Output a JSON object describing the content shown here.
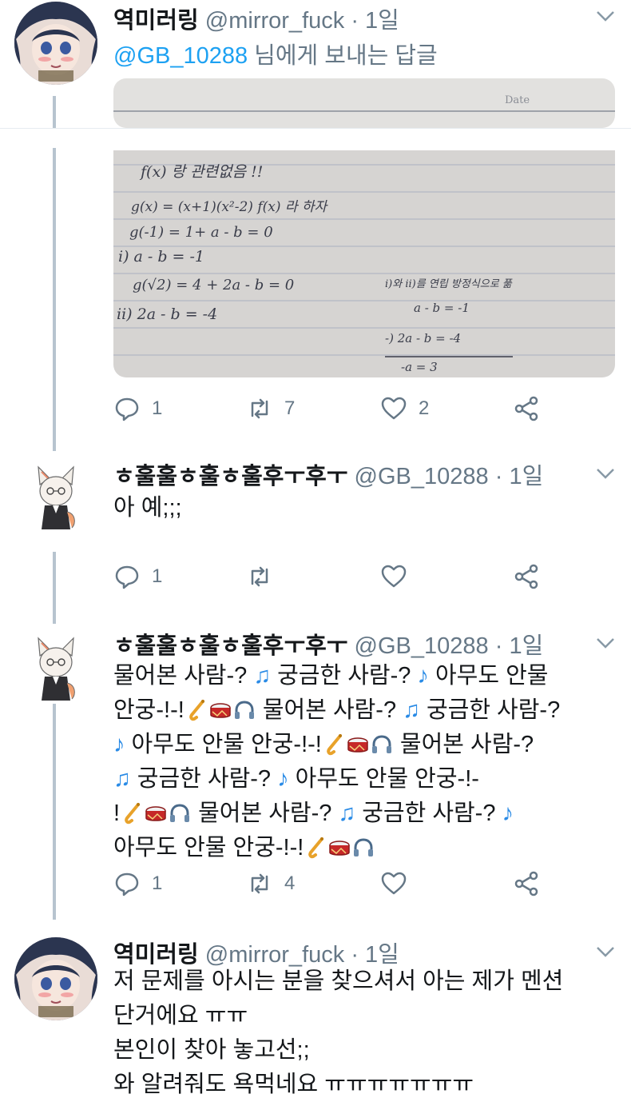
{
  "tweets": [
    {
      "name": "역미러링",
      "handle": "@mirror_fuck",
      "dot": "·",
      "time": "1일",
      "reply_mention": "@GB_10288",
      "reply_rest": " 님에게 보내는 답글",
      "image_top_label": "Date",
      "math_lines": [
        "f(x) 랑 관련없음 !!",
        "g(x) = (x+1)(x²-2) f(x) 라 하자",
        "g(-1) = 1+ a - b = 0",
        "i) a - b = -1",
        "g(√2) = 4 + 2a - b = 0",
        "ii) 2a - b = -4",
        "i)와 ii)를 연립 방정식으로 풂",
        "a - b = -1",
        "-) 2a - b = -4",
        "-a = 3"
      ],
      "replies": "1",
      "retweets": "7",
      "likes": "2"
    },
    {
      "name": "ㅎ훌훌ㅎ훌ㅎ훌후ㅜ후ㅜ",
      "handle": "@GB_10288",
      "dot": "·",
      "time": "1일",
      "text": "아 예;;;",
      "replies": "1",
      "retweets": "",
      "likes": ""
    },
    {
      "name": "ㅎ훌훌ㅎ훌ㅎ훌후ㅜ후ㅜ",
      "handle": "@GB_10288",
      "dot": "·",
      "time": "1일",
      "lines": [
        [
          "물어본 사람-? ",
          "♫",
          " 궁금한 사람-? ",
          "♪",
          " 아무도 안물"
        ],
        [
          "안궁-!-!",
          "",
          " 물어본 사람-? ",
          "♫",
          " 궁금한 사람-?"
        ],
        [
          "♪",
          " 아무도 안물 안궁-!-!",
          "",
          " 물어본 사람-?"
        ],
        [
          "♫",
          " 궁금한 사람-? ",
          "♪",
          " 아무도 안물 안궁-!-"
        ],
        [
          "!",
          "",
          " 물어본 사람-? ",
          "♫",
          " 궁금한 사람-? ",
          "♪"
        ],
        [
          "아무도 안물 안궁-!-!",
          ""
        ]
      ],
      "replies": "1",
      "retweets": "4",
      "likes": ""
    },
    {
      "name": "역미러링",
      "handle": "@mirror_fuck",
      "dot": "·",
      "time": "1일",
      "text_lines": [
        "저 문제를 아시는 분을 찾으셔서 아는 제가 멘션",
        "단거에요 ㅠㅠ",
        "본인이 찾아 놓고선;;",
        "와 알려줘도 욕먹네요 ㅠㅠㅠㅠㅠㅠㅠ"
      ]
    }
  ],
  "colors": {
    "accent": "#1da1f2",
    "muted": "#657786",
    "thread": "#b7c4cf"
  },
  "icons": [
    "reply-icon",
    "retweet-icon",
    "like-icon",
    "share-icon",
    "chevron-down-icon"
  ]
}
